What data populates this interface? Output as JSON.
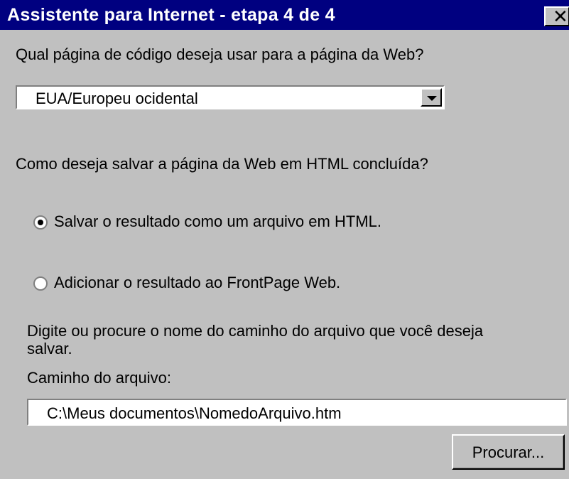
{
  "window": {
    "title": "Assistente para Internet - etapa 4 de 4",
    "close_glyph": "✕"
  },
  "codepage": {
    "question": "Qual página de código deseja usar para a página da Web?",
    "selected": "EUA/Europeu ocidental"
  },
  "save": {
    "question": "Como deseja salvar a página da Web em HTML concluída?",
    "options": [
      {
        "label": "Salvar o resultado como um arquivo em HTML.",
        "checked": true
      },
      {
        "label": "Adicionar o resultado ao FrontPage Web.",
        "checked": false
      }
    ]
  },
  "path": {
    "instructions_line1": "Digite ou procure o nome do caminho do arquivo que você deseja",
    "instructions_line2": "salvar.",
    "field_label": "Caminho do arquivo:",
    "value": "C:\\Meus documentos\\NomedoArquivo.htm"
  },
  "buttons": {
    "browse": "Procurar..."
  },
  "colors": {
    "titlebar": "#000080",
    "face": "#c0c0c0"
  }
}
